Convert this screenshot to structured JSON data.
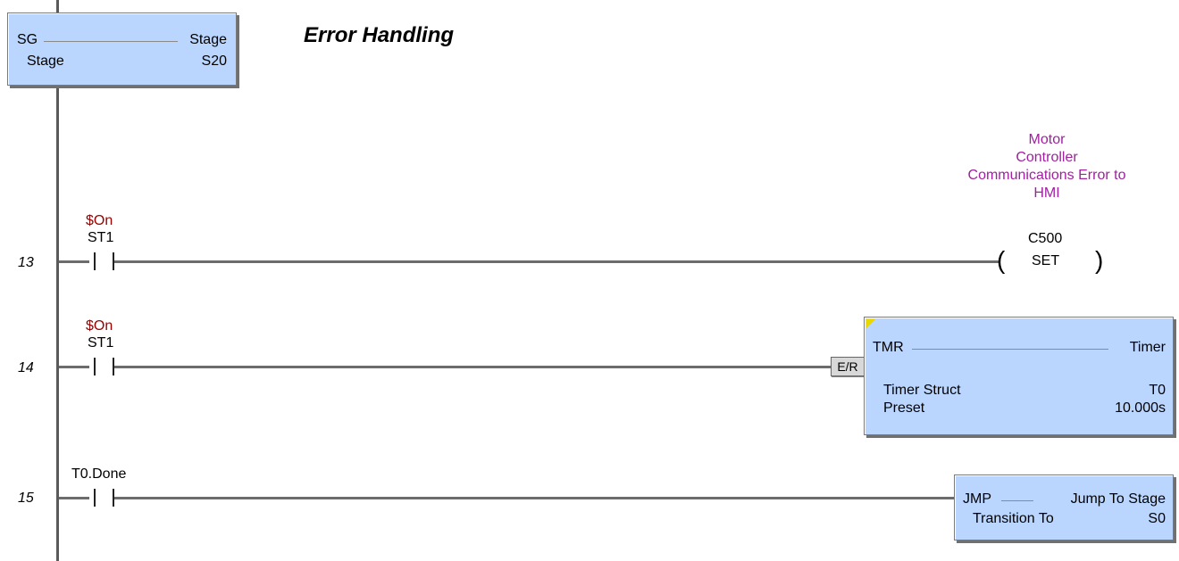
{
  "stage_box": {
    "opcode": "SG",
    "name": "Stage",
    "label": "Stage",
    "address": "S20"
  },
  "title": "Error Handling",
  "rungs": [
    {
      "number": "13",
      "contact_nick": "$On",
      "contact_addr": "ST1",
      "coil_desc": [
        "Motor",
        "Controller",
        "Communications Error to",
        "HMI"
      ],
      "coil_addr": "C500",
      "coil_type": "SET"
    },
    {
      "number": "14",
      "contact_nick": "$On",
      "contact_addr": "ST1",
      "er_label": "E/R",
      "timer": {
        "opcode": "TMR",
        "name": "Timer",
        "struct_label": "Timer Struct",
        "struct_value": "T0",
        "preset_label": "Preset",
        "preset_value": "10.000s"
      }
    },
    {
      "number": "15",
      "contact_addr": "T0.Done",
      "jump": {
        "opcode": "JMP",
        "name": "Jump To Stage",
        "transition_label": "Transition To",
        "transition_value": "S0"
      }
    }
  ],
  "colors": {
    "box_fill": "#bad6ff",
    "nickname": "#990000",
    "description": "#a020a0",
    "wire": "#6c6c6c"
  }
}
